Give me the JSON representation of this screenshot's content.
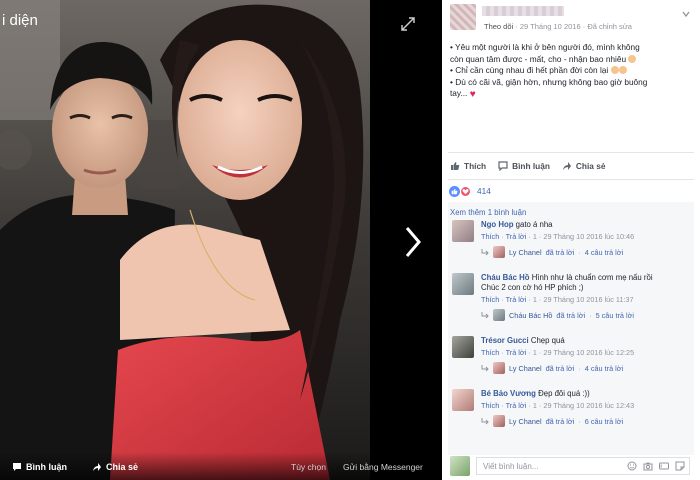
{
  "viewer": {
    "title": "i diện",
    "footer": {
      "comment_label": "Bình luận",
      "share_label": "Chia sẻ",
      "options_label": "Tùy chọn",
      "messenger_label": "Gửi bằng Messenger"
    }
  },
  "post": {
    "follow_label": "Theo dõi",
    "date": "29 Tháng 10 2016",
    "edited_label": "Đã chỉnh sửa",
    "meta_sep": "·",
    "text_lines": [
      "• Yêu một người là khi ở bên người đó, mình không",
      "còn quan tâm được - mất, cho - nhận bao nhiêu",
      "• Chỉ cần cùng nhau đi hết phần đời còn lại",
      "• Dù có cãi vã, giận hờn, nhưng không bao giờ buông",
      "tay..."
    ],
    "actions": {
      "like": "Thích",
      "comment": "Bình luận",
      "share": "Chia sẻ"
    },
    "reaction_count": "414"
  },
  "comments": {
    "more_label": "Xem thêm 1 bình luận",
    "items": [
      {
        "author": "Ngo Hop",
        "text": " gato á nha",
        "like": "Thích",
        "reply": "Trả lời",
        "likes": "1",
        "time": "29 Tháng 10 2016 lúc 10:46",
        "reply_name": "Ly Chanel",
        "reply_action": "đã trả lời",
        "reply_count": "4 câu trả lời"
      },
      {
        "author": "Cháu Bác Hồ",
        "text": " Hình như là chuẩn cơm mẹ nấu rồi",
        "text2": "Chúc 2 con cờ hó HP phích ;)",
        "like": "Thích",
        "reply": "Trả lời",
        "likes": "1",
        "time": "29 Tháng 10 2016 lúc 11:37",
        "reply_name": "Cháu Bác Hồ",
        "reply_action": "đã trả lời",
        "reply_count": "5 câu trả lời"
      },
      {
        "author": "Trésor Gucci",
        "text": " Chẹp quá",
        "like": "Thích",
        "reply": "Trả lời",
        "likes": "1",
        "time": "29 Tháng 10 2016 lúc 12:25",
        "reply_name": "Ly Chanel",
        "reply_action": "đã trả lời",
        "reply_count": "4 câu trả lời"
      },
      {
        "author": "Bé Bảo Vương",
        "text": " Đẹp đôi quá :))",
        "like": "Thích",
        "reply": "Trả lời",
        "likes": "1",
        "time": "29 Tháng 10 2016 lúc 12:43",
        "reply_name": "Ly Chanel",
        "reply_action": "đã trả lời",
        "reply_count": "6 câu trả lời"
      }
    ],
    "composer_placeholder": "Viết bình luận..."
  },
  "colors": {
    "link_blue": "#4267b2",
    "author_blue": "#365899",
    "like_blue": "#5890ff",
    "love_red": "#f25268",
    "dress_red": "#d8353c"
  }
}
